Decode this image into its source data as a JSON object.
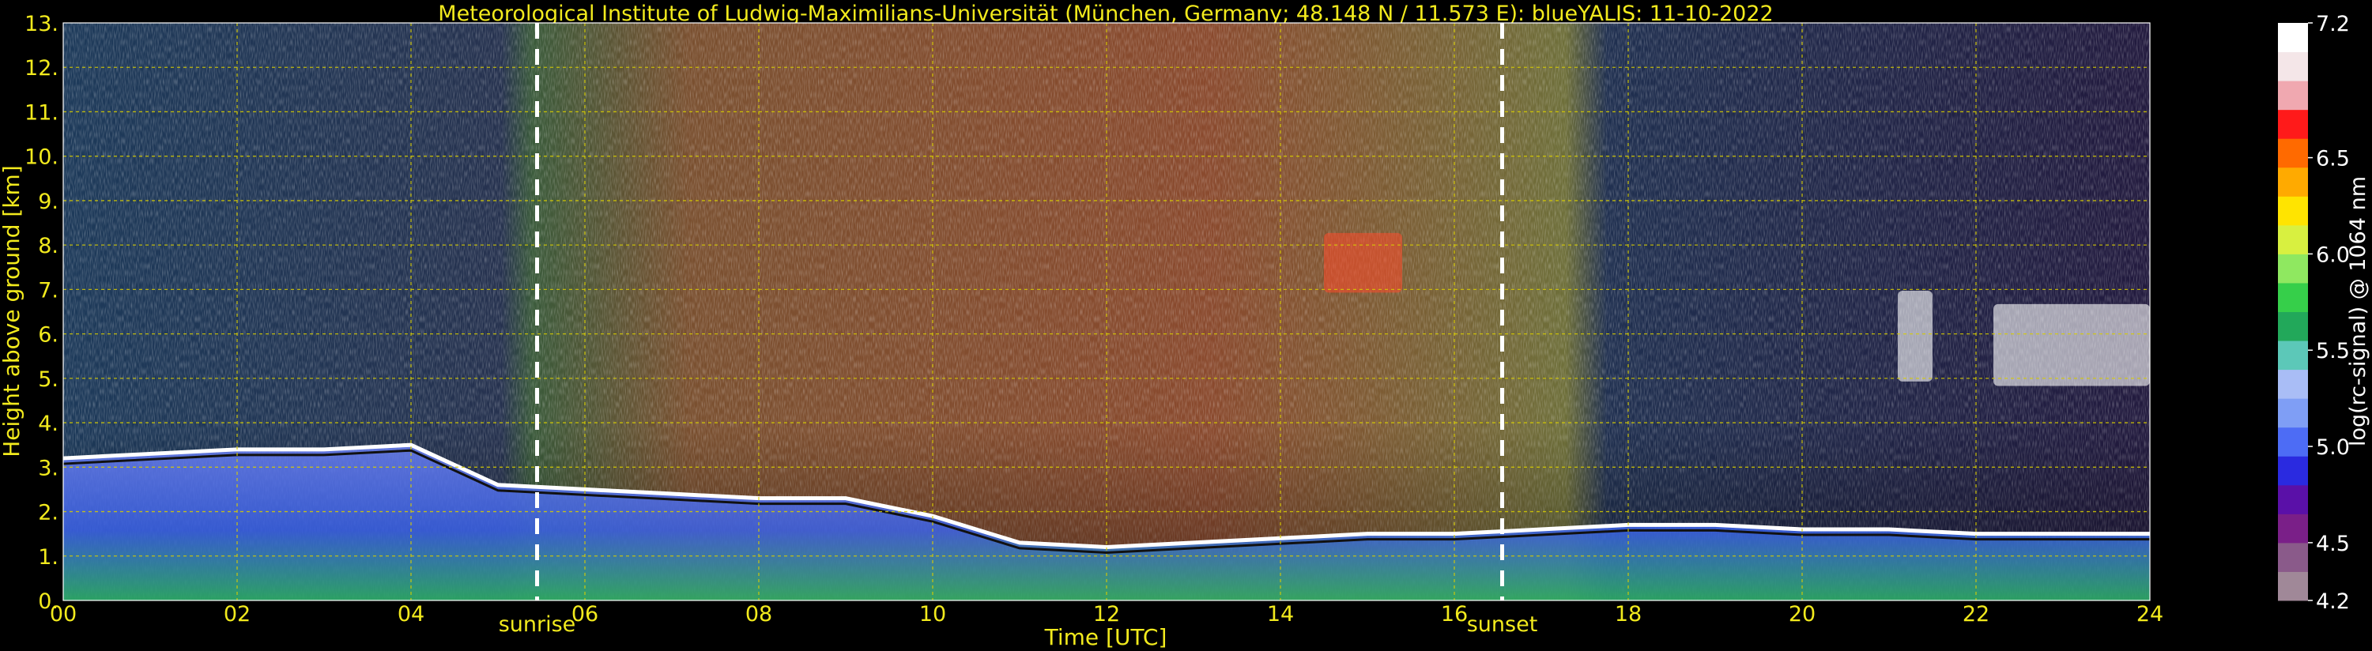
{
  "chart_data": {
    "type": "heatmap",
    "title": "Meteorological Institute of Ludwig-Maximilians-Universität (München, Germany; 48.148 N / 11.573 E):     blueYALIS: 11-10-2022",
    "xlabel": "Time [UTC]",
    "ylabel": "Height above ground [km]",
    "colorbar_label": "log(rc-signal) @ 1064 nm",
    "xlim": [
      0,
      24
    ],
    "ylim": [
      0,
      13
    ],
    "x_ticks": [
      "00",
      "02",
      "04",
      "06",
      "08",
      "10",
      "12",
      "14",
      "16",
      "18",
      "20",
      "22",
      "24"
    ],
    "y_ticks": [
      "0.",
      "1.",
      "2.",
      "3.",
      "4.",
      "5.",
      "6.",
      "7.",
      "8.",
      "9.",
      "10.",
      "11.",
      "12.",
      "13."
    ],
    "colorbar_ticks": [
      "4.2",
      "4.5",
      "5.0",
      "5.5",
      "6.0",
      "6.5",
      "7.2"
    ],
    "colorbar_range": [
      4.2,
      7.2
    ],
    "grid": true,
    "events": [
      {
        "label": "sunrise",
        "time": 5.45
      },
      {
        "label": "sunset",
        "time": 16.55
      }
    ],
    "colormap": [
      "#a08898",
      "#8a5a8a",
      "#7a1f88",
      "#5a10a8",
      "#2a2ae0",
      "#4d6cf5",
      "#7f9ef5",
      "#a9bdf6",
      "#5cc8b8",
      "#22a85a",
      "#36cf4a",
      "#8fe860",
      "#d8f040",
      "#ffe400",
      "#ffaa00",
      "#ff6a00",
      "#ff1a1a",
      "#f0a8b0",
      "#f4e6e8",
      "#ffffff"
    ],
    "main_layers": [
      {
        "name": "boundary layer top",
        "start": 0,
        "end": 24,
        "height_km": [
          3.2,
          3.3,
          3.4,
          3.4,
          3.5,
          2.6,
          2.5,
          2.4,
          2.3,
          2.3,
          1.9,
          1.3,
          1.2,
          1.3,
          1.4,
          1.5,
          1.5,
          1.6,
          1.7,
          1.7,
          1.6,
          1.6,
          1.5,
          1.5,
          1.5
        ]
      },
      {
        "name": "cirrus",
        "start": 14.5,
        "end": 15.4,
        "height_km": [
          8.2,
          7.0
        ]
      },
      {
        "name": "cloud layer",
        "start": 21.1,
        "end": 21.5,
        "height_km": [
          6.9,
          5.0
        ]
      },
      {
        "name": "cloud layer",
        "start": 22.2,
        "end": 24.0,
        "height_km": [
          6.6,
          4.9
        ]
      }
    ]
  }
}
